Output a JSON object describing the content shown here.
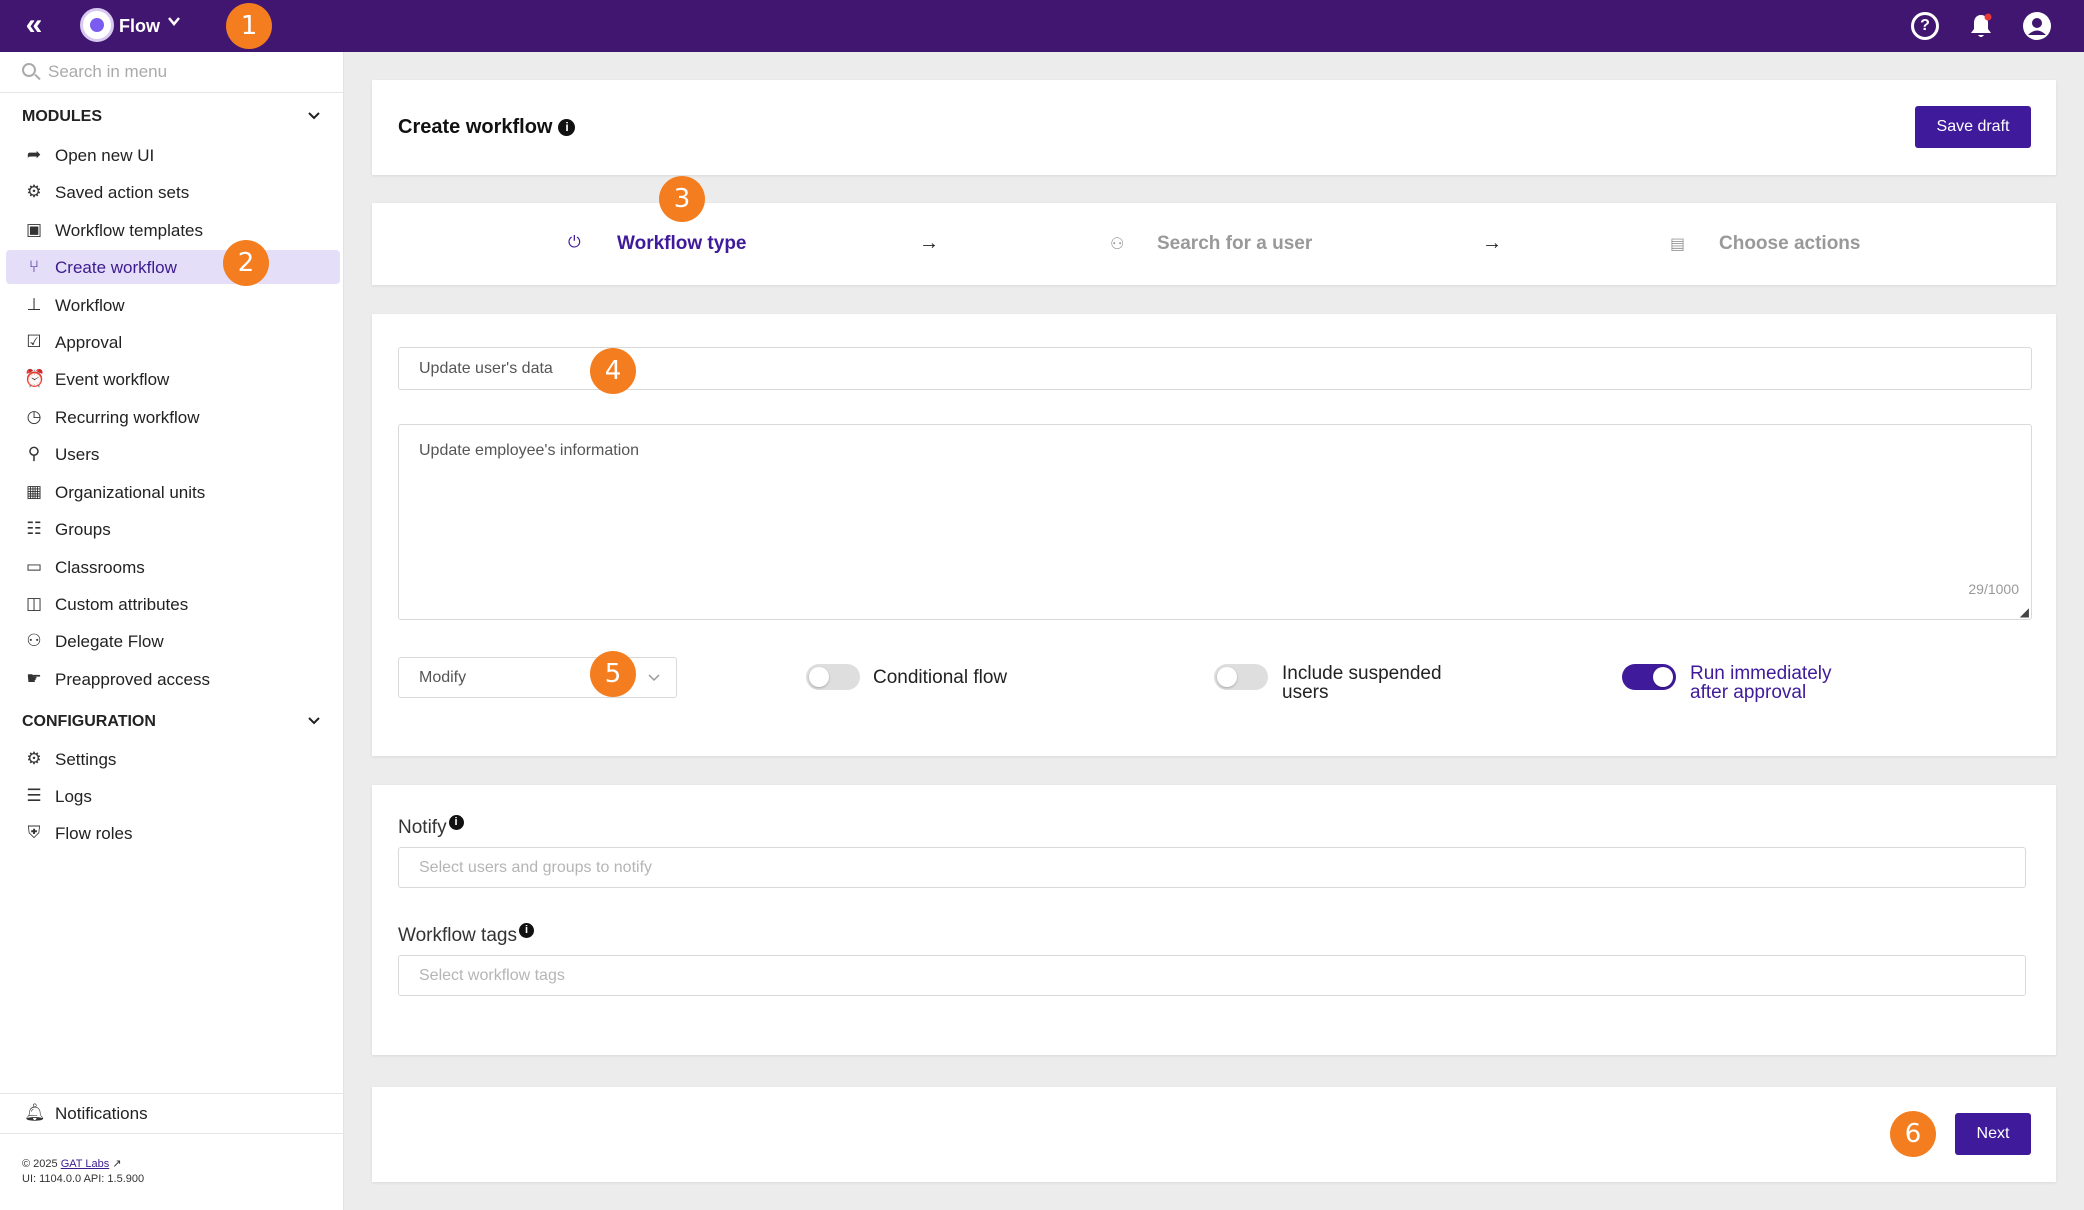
{
  "topbar": {
    "collapse_label": "«",
    "app_name": "Flow",
    "app_chevron": "⌄",
    "icons": [
      "double-chevron-left-icon",
      "flow-logo-icon",
      "help-icon",
      "bell-icon",
      "user-account-icon"
    ],
    "bell_badge_color": "#e53935",
    "bg_color": "#411670"
  },
  "markers": [
    "1",
    "2",
    "3",
    "4",
    "5",
    "6"
  ],
  "sidebar": {
    "search_placeholder": "Search in menu",
    "modules_title": "MODULES",
    "configuration_title": "CONFIGURATION",
    "modules": [
      {
        "label": "Open new UI",
        "icon": "arrow-share-icon"
      },
      {
        "label": "Saved action sets",
        "icon": "gears-icon"
      },
      {
        "label": "Workflow templates",
        "icon": "template-icon"
      },
      {
        "label": "Create workflow",
        "icon": "branch-icon"
      },
      {
        "label": "Workflow",
        "icon": "hierarchy-icon"
      },
      {
        "label": "Approval",
        "icon": "approval-icon"
      },
      {
        "label": "Event workflow",
        "icon": "alarm-icon"
      },
      {
        "label": "Recurring workflow",
        "icon": "clock-icon"
      },
      {
        "label": "Users",
        "icon": "user-search-icon"
      },
      {
        "label": "Organizational units",
        "icon": "building-icon"
      },
      {
        "label": "Groups",
        "icon": "groups-icon"
      },
      {
        "label": "Classrooms",
        "icon": "classroom-icon"
      },
      {
        "label": "Custom attributes",
        "icon": "attributes-icon"
      },
      {
        "label": "Delegate Flow",
        "icon": "delegate-icon"
      },
      {
        "label": "Preapproved access",
        "icon": "preapproved-icon"
      }
    ],
    "configuration": [
      {
        "label": "Settings",
        "icon": "gear-icon"
      },
      {
        "label": "Logs",
        "icon": "list-icon"
      },
      {
        "label": "Flow roles",
        "icon": "shield-icon"
      }
    ],
    "notifications_label": "Notifications",
    "footer_copyright": "© 2025",
    "footer_company": "GAT Labs",
    "footer_versions": "UI: 1104.0.0 API: 1.5.900"
  },
  "header": {
    "title": "Create workflow",
    "save_draft_label": "Save draft"
  },
  "stepper": {
    "steps": [
      {
        "label": "Workflow type",
        "icon": "power-icon",
        "active": true
      },
      {
        "label": "Search for a user",
        "icon": "people-icon",
        "active": false
      },
      {
        "label": "Choose actions",
        "icon": "clipboard-icon",
        "active": false
      }
    ],
    "arrow": "→"
  },
  "form": {
    "name_value": "Update user's data",
    "description_value": "Update employee's information",
    "char_count": "29/1000",
    "type_select_value": "Modify",
    "toggles": [
      {
        "label_line1": "Conditional flow",
        "label_line2": "",
        "on": false
      },
      {
        "label_line1": "Include suspended",
        "label_line2": "users",
        "on": false
      },
      {
        "label_line1": "Run immediately",
        "label_line2": "after approval",
        "on": true
      }
    ]
  },
  "notify": {
    "label": "Notify",
    "placeholder": "Select users and groups to notify",
    "tags_label": "Workflow tags",
    "tags_placeholder": "Select workflow tags"
  },
  "footer_card": {
    "next_label": "Next"
  },
  "colors": {
    "accent": "#3f1a9a",
    "marker": "#f47d1f",
    "active_bg": "#e4def8"
  }
}
